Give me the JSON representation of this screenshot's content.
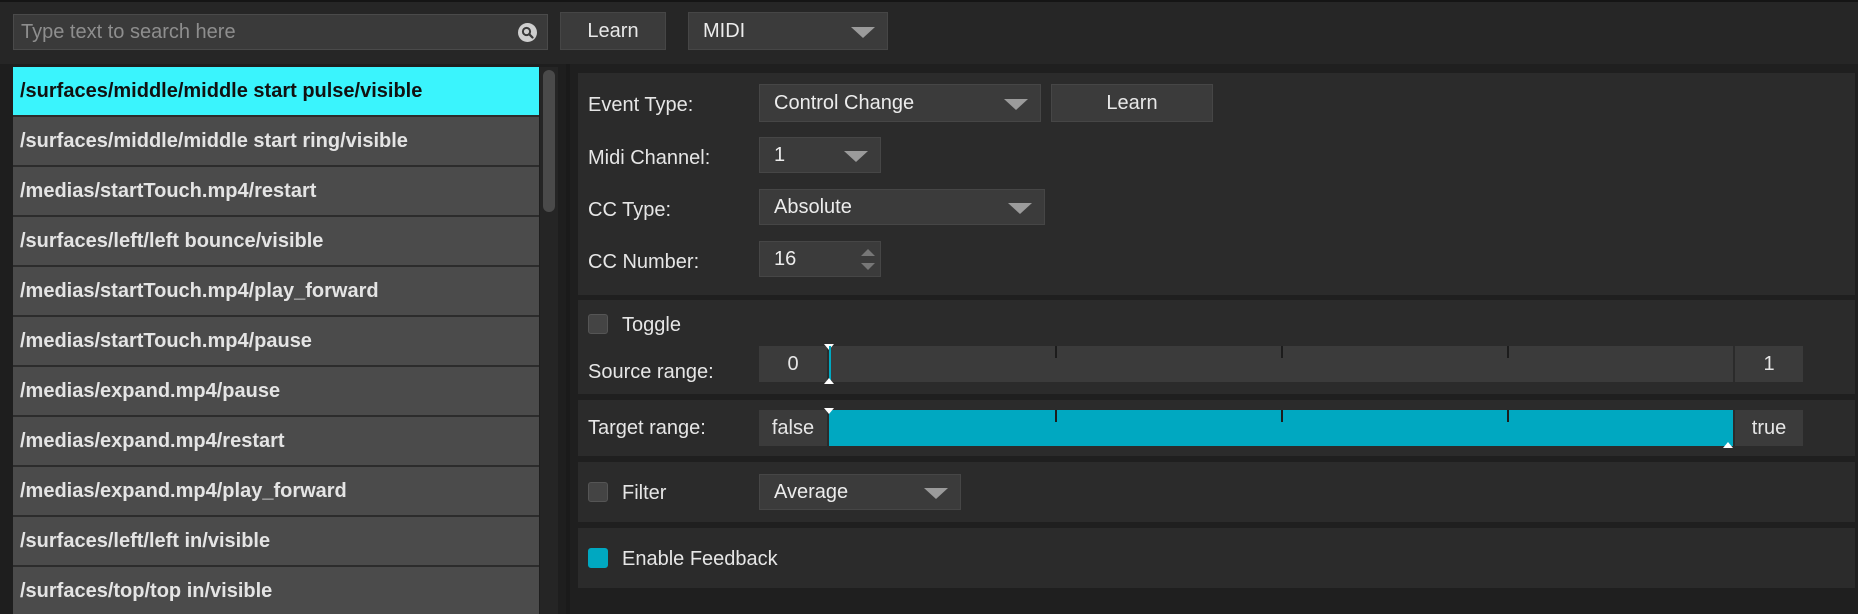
{
  "toolbar": {
    "search_placeholder": "Type text to search here",
    "learn_label": "Learn",
    "protocol_value": "MIDI"
  },
  "list": {
    "selected_index": 0,
    "items": [
      "/surfaces/middle/middle start pulse/visible",
      "/surfaces/middle/middle start ring/visible",
      "/medias/startTouch.mp4/restart",
      "/surfaces/left/left bounce/visible",
      "/medias/startTouch.mp4/play_forward",
      "/medias/startTouch.mp4/pause",
      "/medias/expand.mp4/pause",
      "/medias/expand.mp4/restart",
      "/medias/expand.mp4/play_forward",
      "/surfaces/left/left in/visible",
      "/surfaces/top/top in/visible"
    ]
  },
  "midi": {
    "event_type_label": "Event Type:",
    "event_type_value": "Control Change",
    "learn_label": "Learn",
    "channel_label": "Midi Channel:",
    "channel_value": "1",
    "cc_type_label": "CC Type:",
    "cc_type_value": "Absolute",
    "cc_number_label": "CC Number:",
    "cc_number_value": "16"
  },
  "mapping": {
    "toggle_label": "Toggle",
    "toggle_checked": false,
    "source_label": "Source range:",
    "source_min": "0",
    "source_max": "1",
    "source_fill": [
      0.0,
      0.0
    ],
    "target_label": "Target range:",
    "target_min": "false",
    "target_max": "true",
    "target_fill": [
      0.0,
      1.0
    ]
  },
  "filter": {
    "label": "Filter",
    "checked": false,
    "mode_value": "Average"
  },
  "feedback": {
    "label": "Enable Feedback",
    "checked": true
  },
  "colors": {
    "accent": "#00a8c1",
    "selection": "#3af4fd"
  }
}
